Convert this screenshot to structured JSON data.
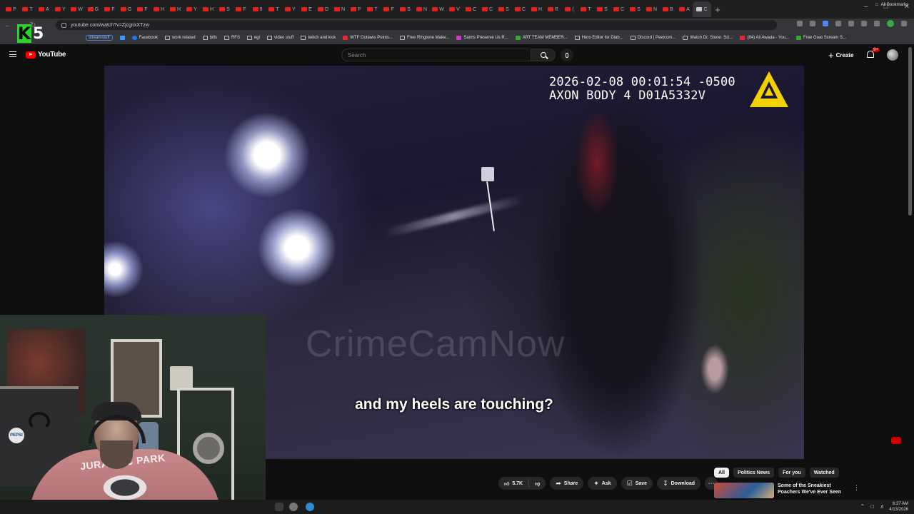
{
  "browser": {
    "tab_letters": [
      "P",
      "T",
      "A",
      "Y",
      "W",
      "G",
      "F",
      "G",
      "F",
      "H",
      "H",
      "Y",
      "H",
      "S",
      "F",
      "9",
      "T",
      "Y",
      "E",
      "D",
      "N",
      "F",
      "T",
      "F",
      "S",
      "N",
      "W",
      "V",
      "C",
      "C",
      "S",
      "C",
      "H",
      "R",
      "(",
      "T",
      "S",
      "C",
      "S",
      "N",
      "B",
      "A",
      "C"
    ],
    "url": "youtube.com/watch?v=ZjcgrixXTzw",
    "bookmarks": [
      {
        "label": "streamstuff",
        "icon": "chip"
      },
      {
        "label": "",
        "icon": "grid-icon"
      },
      {
        "label": "Facebook",
        "icon": "facebook-icon"
      },
      {
        "label": "work related",
        "icon": "folder-icon"
      },
      {
        "label": "bills",
        "icon": "folder-icon"
      },
      {
        "label": "RFS",
        "icon": "folder-icon"
      },
      {
        "label": "egl",
        "icon": "folder-icon"
      },
      {
        "label": "video stuff",
        "icon": "folder-icon"
      },
      {
        "label": "twitch and kick",
        "icon": "folder-icon"
      },
      {
        "label": "WTF Outlaws Points...",
        "icon": "red-icon"
      },
      {
        "label": "Free Ringtone Make...",
        "icon": "folder-icon"
      },
      {
        "label": "Saints Preserve Us R...",
        "icon": "pink-icon"
      },
      {
        "label": "ART TEAM MEMBER...",
        "icon": "green-icon"
      },
      {
        "label": "Hero Editor for Diab...",
        "icon": "folder-icon"
      },
      {
        "label": "Discord | Peelcom...",
        "icon": "folder-icon"
      },
      {
        "label": "Watch Dr. Stone: Sci...",
        "icon": "folder-icon"
      },
      {
        "label": "(84) Ali Awada - You...",
        "icon": "red-icon"
      },
      {
        "label": "Free Goat Scream S...",
        "icon": "green-icon"
      }
    ],
    "all_bookmarks": "All Bookmarks"
  },
  "stream_logo": {
    "letter": "K",
    "number": "5"
  },
  "youtube": {
    "logo_text": "YouTube",
    "search_placeholder": "Search",
    "create_label": "Create",
    "notifications_badge": "9+"
  },
  "video": {
    "timestamp_line1": "2026-02-08 00:01:54 -0500",
    "timestamp_line2": "AXON BODY 4 D01A5332V",
    "watermark": "CrimeCamNow",
    "subtitle": "and my heels are touching?"
  },
  "webcam": {
    "shirt_text": "JURASSIC PARK",
    "pepsi_label": "PEPSI"
  },
  "actions": {
    "likes": "5.7K",
    "share": "Share",
    "ask": "Ask",
    "save": "Save",
    "download": "Download"
  },
  "chips": [
    "All",
    "Politics News",
    "For you",
    "Watched"
  ],
  "recommendation": {
    "title": "Some of the Sneakiest Poachers We've Ever Seen"
  },
  "taskbar": {
    "time": "6:27 AM",
    "date": "4/13/2026"
  }
}
